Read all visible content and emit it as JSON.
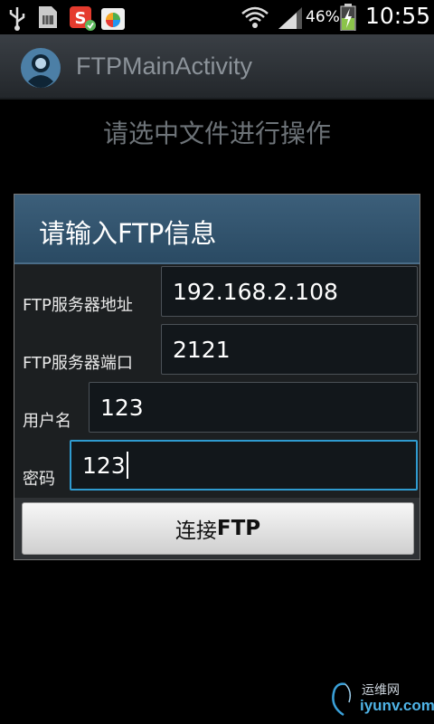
{
  "status_bar": {
    "battery_percent": "46%",
    "time": "10:55",
    "icons": [
      "usb-icon",
      "sim-icon",
      "app-s-icon",
      "shop-icon",
      "wifi-icon",
      "signal-icon",
      "battery-charging-icon"
    ]
  },
  "action_bar": {
    "title": "FTPMainActivity",
    "icon": "app-avatar-icon"
  },
  "main": {
    "hint": "请选中文件进行操作"
  },
  "dialog": {
    "title": "请输入FTP信息",
    "fields": [
      {
        "label": "FTP服务器地址",
        "value": "192.168.2.108"
      },
      {
        "label": "FTP服务器端口",
        "value": "2121"
      },
      {
        "label": "用户名",
        "value": "123"
      },
      {
        "label": "密码",
        "value": "123"
      }
    ],
    "connect_label_prefix": "连接",
    "connect_label_bold": "FTP"
  },
  "watermark": {
    "line1": "运维网",
    "line2": "iyunv.com"
  },
  "colors": {
    "accent": "#2f9bd0",
    "dialog_header": "#3c5f7a",
    "background": "#000000"
  }
}
